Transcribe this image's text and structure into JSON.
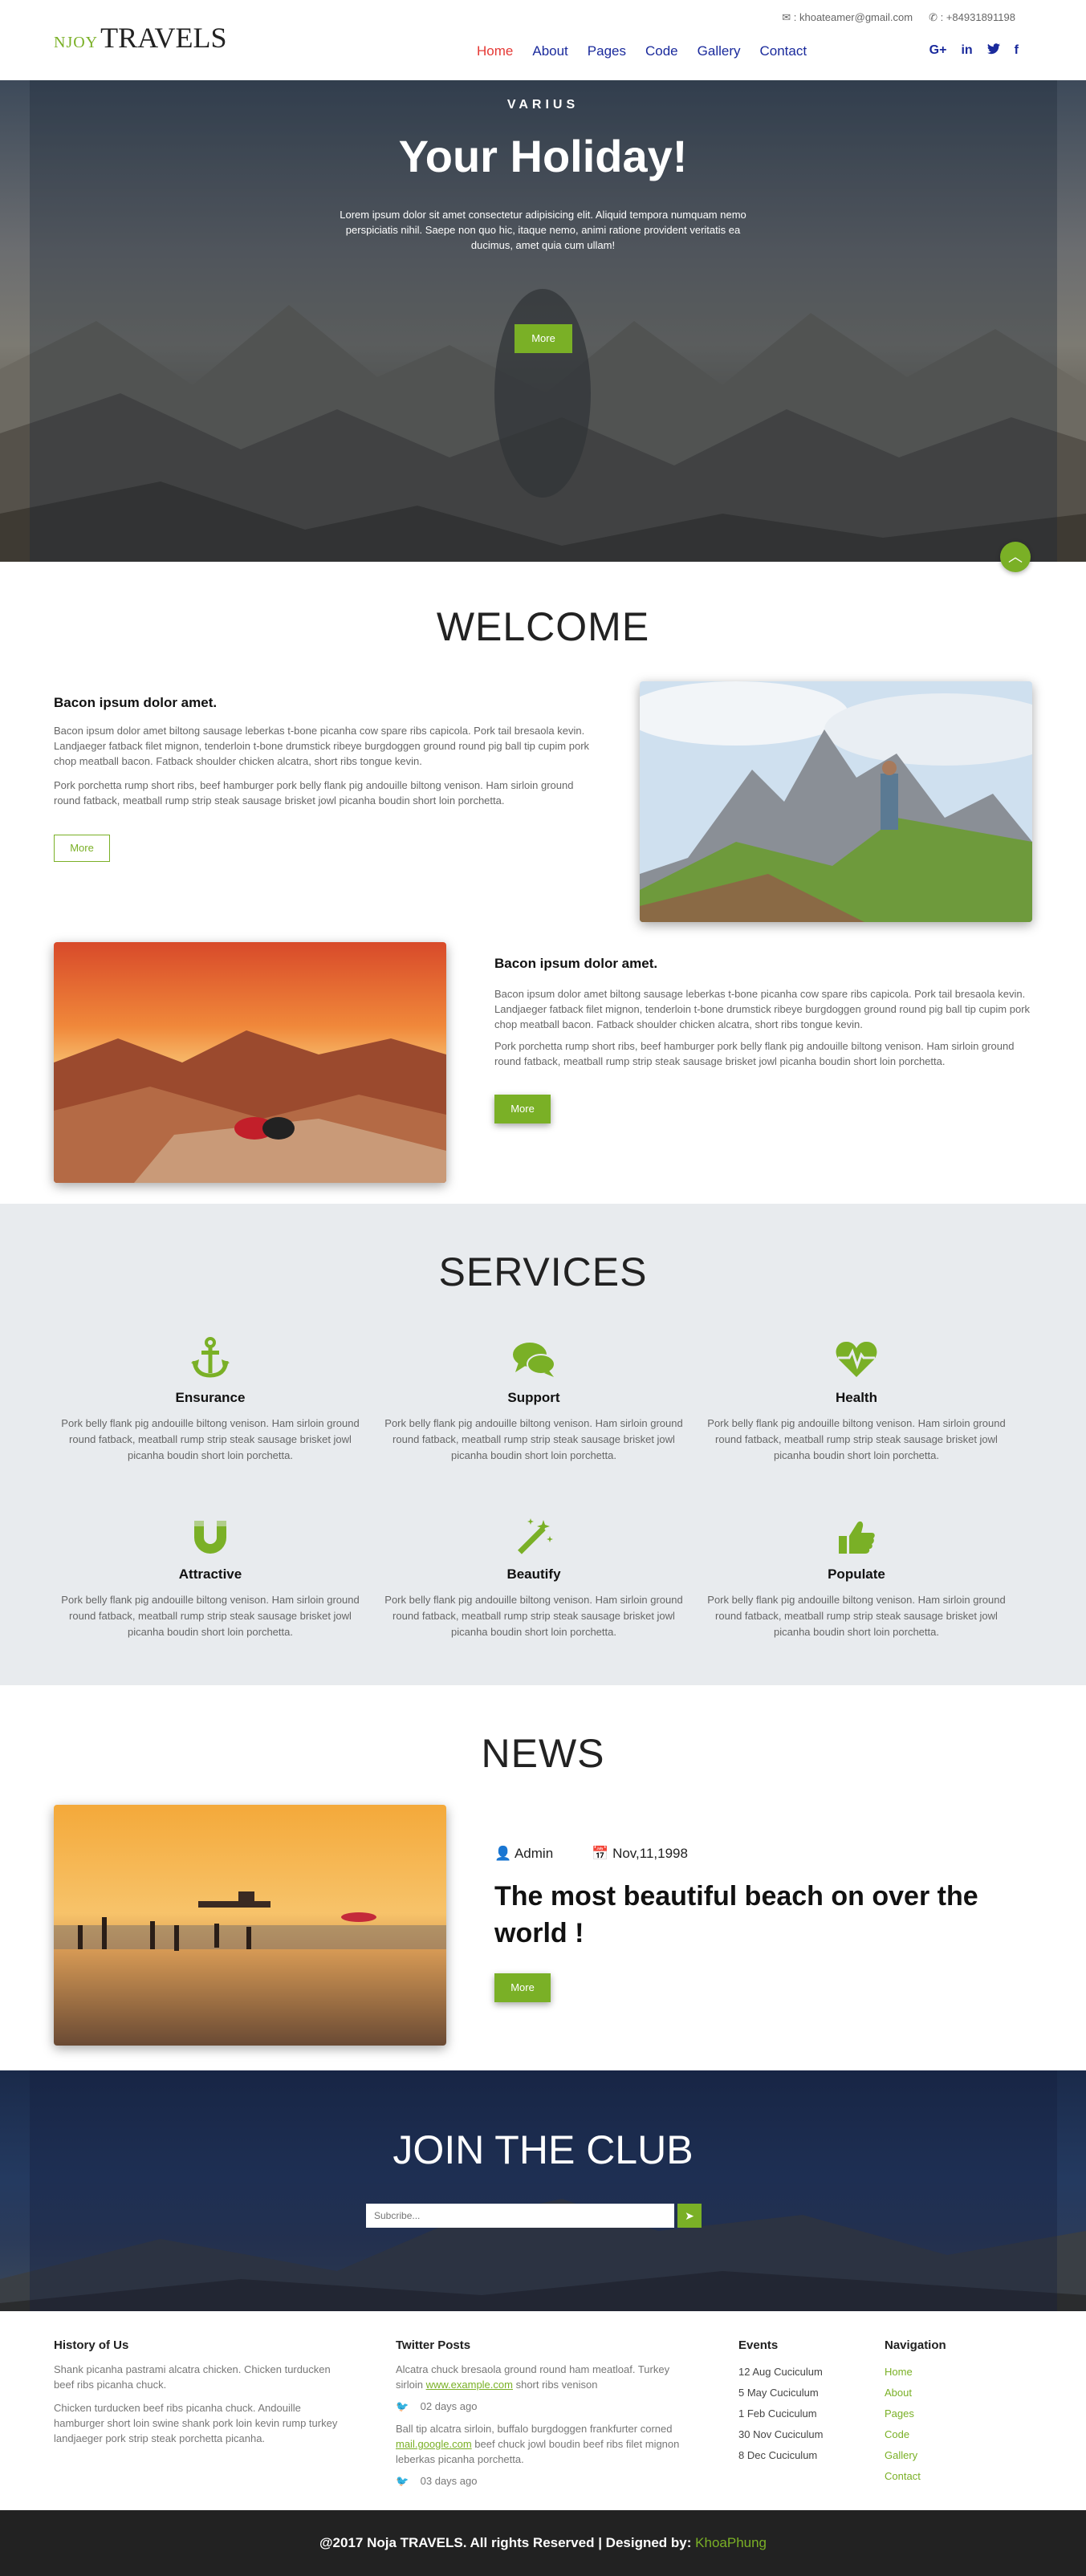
{
  "header": {
    "logo_small": "NJOY",
    "logo_big": "TRAVELS",
    "email": "khoateamer@gmail.com",
    "phone": "+84931891198",
    "nav": [
      "Home",
      "About",
      "Pages",
      "Code",
      "Gallery",
      "Contact"
    ],
    "social": [
      "G+",
      "in",
      "twitter",
      "f"
    ]
  },
  "hero": {
    "subtitle": "VARIUS",
    "title": "Your Holiday!",
    "text": "Lorem ipsum dolor sit amet consectetur adipisicing elit. Aliquid tempora numquam nemo perspiciatis nihil. Saepe non quo hic, itaque nemo, animi ratione provident veritatis ea ducimus, amet quia cum ullam!",
    "button": "More"
  },
  "welcome": {
    "title": "WELCOME",
    "block1": {
      "heading": "Bacon ipsum dolor amet.",
      "p1": "Bacon ipsum dolor amet biltong sausage leberkas t-bone picanha cow spare ribs capicola. Pork tail bresaola kevin. Landjaeger fatback filet mignon, tenderloin t-bone drumstick ribeye burgdoggen ground round pig ball tip cupim pork chop meatball bacon. Fatback shoulder chicken alcatra, short ribs tongue kevin.",
      "p2": "Pork porchetta rump short ribs, beef hamburger pork belly flank pig andouille biltong venison. Ham sirloin ground round fatback, meatball rump strip steak sausage brisket jowl picanha boudin short loin porchetta.",
      "button": "More"
    },
    "block2": {
      "heading": "Bacon ipsum dolor amet.",
      "p1": "Bacon ipsum dolor amet biltong sausage leberkas t-bone picanha cow spare ribs capicola. Pork tail bresaola kevin. Landjaeger fatback filet mignon, tenderloin t-bone drumstick ribeye burgdoggen ground round pig ball tip cupim pork chop meatball bacon. Fatback shoulder chicken alcatra, short ribs tongue kevin.",
      "p2": "Pork porchetta rump short ribs, beef hamburger pork belly flank pig andouille biltong venison. Ham sirloin ground round fatback, meatball rump strip steak sausage brisket jowl picanha boudin short loin porchetta.",
      "button": "More"
    }
  },
  "services": {
    "title": "SERVICES",
    "items": [
      {
        "icon": "anchor-icon",
        "title": "Ensurance",
        "text": "Pork belly flank pig andouille biltong venison. Ham sirloin ground round fatback, meatball rump strip steak sausage brisket jowl picanha boudin short loin porchetta."
      },
      {
        "icon": "comments-icon",
        "title": "Support",
        "text": "Pork belly flank pig andouille biltong venison. Ham sirloin ground round fatback, meatball rump strip steak sausage brisket jowl picanha boudin short loin porchetta."
      },
      {
        "icon": "heartbeat-icon",
        "title": "Health",
        "text": "Pork belly flank pig andouille biltong venison. Ham sirloin ground round fatback, meatball rump strip steak sausage brisket jowl picanha boudin short loin porchetta."
      },
      {
        "icon": "magnet-icon",
        "title": "Attractive",
        "text": "Pork belly flank pig andouille biltong venison. Ham sirloin ground round fatback, meatball rump strip steak sausage brisket jowl picanha boudin short loin porchetta."
      },
      {
        "icon": "magic-wand-icon",
        "title": "Beautify",
        "text": "Pork belly flank pig andouille biltong venison. Ham sirloin ground round fatback, meatball rump strip steak sausage brisket jowl picanha boudin short loin porchetta."
      },
      {
        "icon": "thumbs-up-icon",
        "title": "Populate",
        "text": "Pork belly flank pig andouille biltong venison. Ham sirloin ground round fatback, meatball rump strip steak sausage brisket jowl picanha boudin short loin porchetta."
      }
    ]
  },
  "news": {
    "title": "NEWS",
    "author": "Admin",
    "date": "Nov,11,1998",
    "headline": "The most beautiful beach on over the world !",
    "button": "More"
  },
  "join": {
    "title": "JOIN THE CLUB",
    "placeholder": "Subcribe..."
  },
  "footer": {
    "history": {
      "heading": "History of Us",
      "p1": "Shank picanha pastrami alcatra chicken. Chicken turducken beef ribs picanha chuck.",
      "p2": "Chicken turducken beef ribs picanha chuck. Andouille hamburger short loin swine shank pork loin kevin rump turkey landjaeger pork strip steak porchetta picanha."
    },
    "twitter": {
      "heading": "Twitter Posts",
      "post1_before": "Alcatra chuck bresaola ground round ham meatloaf. Turkey sirloin",
      "post1_link": "www.example.com",
      "post1_after": "short ribs venison",
      "post1_time": "02 days ago",
      "post2_before": "Ball tip alcatra sirloin, buffalo burgdoggen frankfurter corned",
      "post2_link": "mail.google.com",
      "post2_after": "beef chuck jowl boudin beef ribs filet mignon leberkas picanha porchetta.",
      "post2_time": "03 days ago"
    },
    "events": {
      "heading": "Events",
      "items": [
        "12 Aug Cuciculum",
        "5 May Cuciculum",
        "1 Feb Cuciculum",
        "30 Nov Cuciculum",
        "8 Dec Cuciculum"
      ]
    },
    "navigation": {
      "heading": "Navigation",
      "items": [
        "Home",
        "About",
        "Pages",
        "Code",
        "Gallery",
        "Contact"
      ]
    },
    "copyright": "@2017 Noja TRAVELS. All rights Reserved | Designed by:",
    "designer": "KhoaPhung"
  },
  "colors": {
    "accent": "#7ab026",
    "nav": "#1a2a9c",
    "active": "#e53935",
    "footer_bar": "#222222"
  }
}
